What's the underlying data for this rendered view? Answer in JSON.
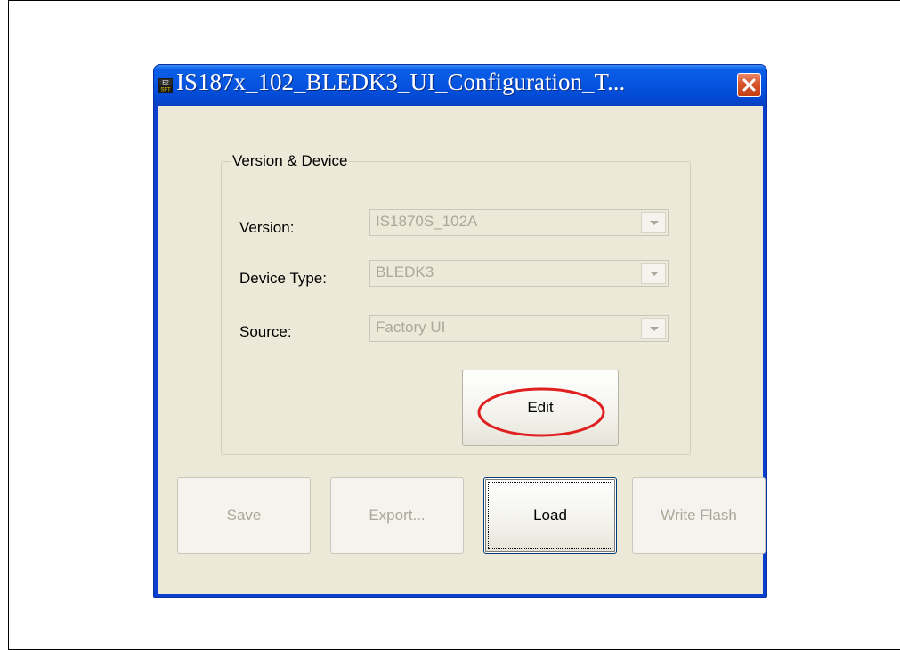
{
  "window": {
    "title": "IS187x_102_BLEDK3_UI_Configuration_T...",
    "app_icon": "e2-sft-app-icon",
    "close_icon": "close-icon"
  },
  "group": {
    "title": "Version & Device",
    "fields": [
      {
        "label": "Version:",
        "value": "IS1870S_102A",
        "disabled": true
      },
      {
        "label": "Device Type:",
        "value": "BLEDK3",
        "disabled": true
      },
      {
        "label": "Source:",
        "value": "Factory UI",
        "disabled": true
      }
    ],
    "edit_button": "Edit"
  },
  "buttons": {
    "save": "Save",
    "export": "Export...",
    "load": "Load",
    "write_flash": "Write Flash"
  },
  "colors": {
    "titlebar": "#0655e0",
    "client_bg": "#ece9d8",
    "close_button": "#d8552c",
    "disabled_text": "#aca899",
    "highlight_ellipse": "#e02020"
  }
}
